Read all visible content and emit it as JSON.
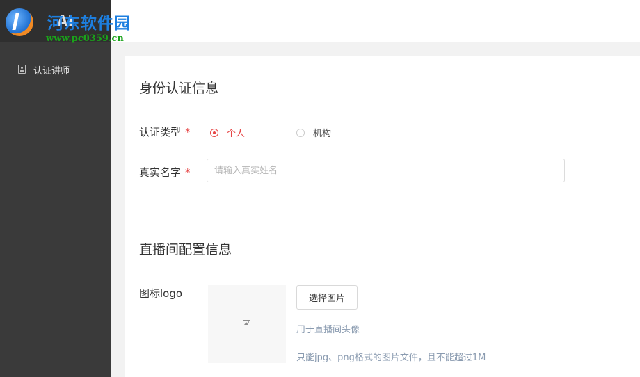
{
  "header": {
    "brand": "河东软件园",
    "brand_url": "www.pc0359.cn",
    "brand_overlay": "AI"
  },
  "sidebar": {
    "items": [
      {
        "label": "认证讲师",
        "icon": "id-card-icon"
      }
    ]
  },
  "identity_section": {
    "title": "身份认证信息",
    "type_label": "认证类型",
    "required_mark": "*",
    "options": [
      {
        "label": "个人",
        "checked": true
      },
      {
        "label": "机构",
        "checked": false
      }
    ],
    "name_label": "真实名字",
    "name_placeholder": "请输入真实姓名",
    "name_value": ""
  },
  "live_section": {
    "title": "直播间配置信息",
    "logo_label": "图标logo",
    "select_button": "选择图片",
    "hint_1": "用于直播间头像",
    "hint_2": "只能jpg、png格式的图片文件，且不能超过1M",
    "placeholder_icon": "image-icon"
  },
  "colors": {
    "accent": "#e64545",
    "sidebar_bg": "#3a3a3a",
    "hint_text": "#8a9bb0"
  }
}
